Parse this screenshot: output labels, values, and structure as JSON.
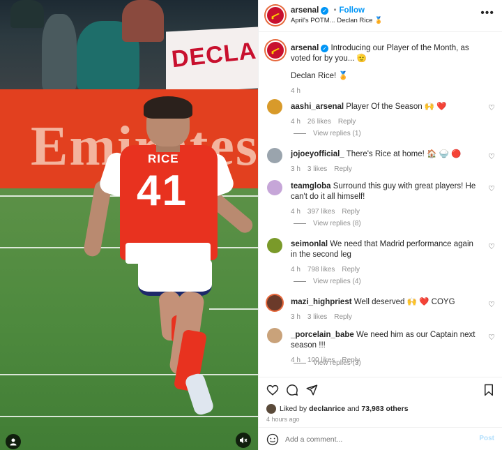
{
  "post": {
    "account": "arsenal",
    "follow_label": "Follow",
    "dot": "•",
    "subtitle": "April's POTM... Declan Rice 🏅",
    "more_icon": "more-horizontal-icon"
  },
  "caption": {
    "account": "arsenal",
    "text": "Introducing our Player of the Month, as voted for by you... 🫡",
    "line2": "Declan Rice! 🏅",
    "time": "4 h"
  },
  "comments": [
    {
      "user": "aashi_arsenal",
      "text": "Player Of the Season 🙌 ❤️",
      "time": "4 h",
      "likes": "26 likes",
      "reply": "Reply",
      "replies": "View replies (1)"
    },
    {
      "user": "jojoeyofficial_",
      "text": "There's Rice at home! 🏠 🍚 🔴",
      "time": "3 h",
      "likes": "3 likes",
      "reply": "Reply",
      "replies": ""
    },
    {
      "user": "teamgloba",
      "text": "Surround this guy with great players! He can't do it all himself!",
      "time": "4 h",
      "likes": "397 likes",
      "reply": "Reply",
      "replies": "View replies (8)"
    },
    {
      "user": "seimonlal",
      "text": "We need that Madrid performance again in the second leg",
      "time": "4 h",
      "likes": "798 likes",
      "reply": "Reply",
      "replies": "View replies (4)"
    },
    {
      "user": "mazi_highpriest",
      "text": "Well deserved 🙌 ❤️ COYG",
      "time": "3 h",
      "likes": "3 likes",
      "reply": "Reply",
      "replies": ""
    },
    {
      "user": "_porcelain_babe",
      "text": "We need him as our Captain next season !!!",
      "time": "4 h",
      "likes": "100 likes",
      "reply": "Reply",
      "replies": "View replies (3)"
    }
  ],
  "likes": {
    "prefix": "Liked by ",
    "user": "declanrice",
    "mid": " and ",
    "count": "73,983 others",
    "time": "4 hours ago"
  },
  "composer": {
    "placeholder": "Add a comment...",
    "post_label": "Post"
  },
  "media": {
    "jersey_name": "RICE",
    "jersey_number": "41",
    "board_text": "Emirates",
    "banner_text": "DECLA"
  },
  "colors": {
    "accent_blue": "#0095f6",
    "arsenal_red": "#c8102e",
    "muted": "#8e8e8e"
  }
}
